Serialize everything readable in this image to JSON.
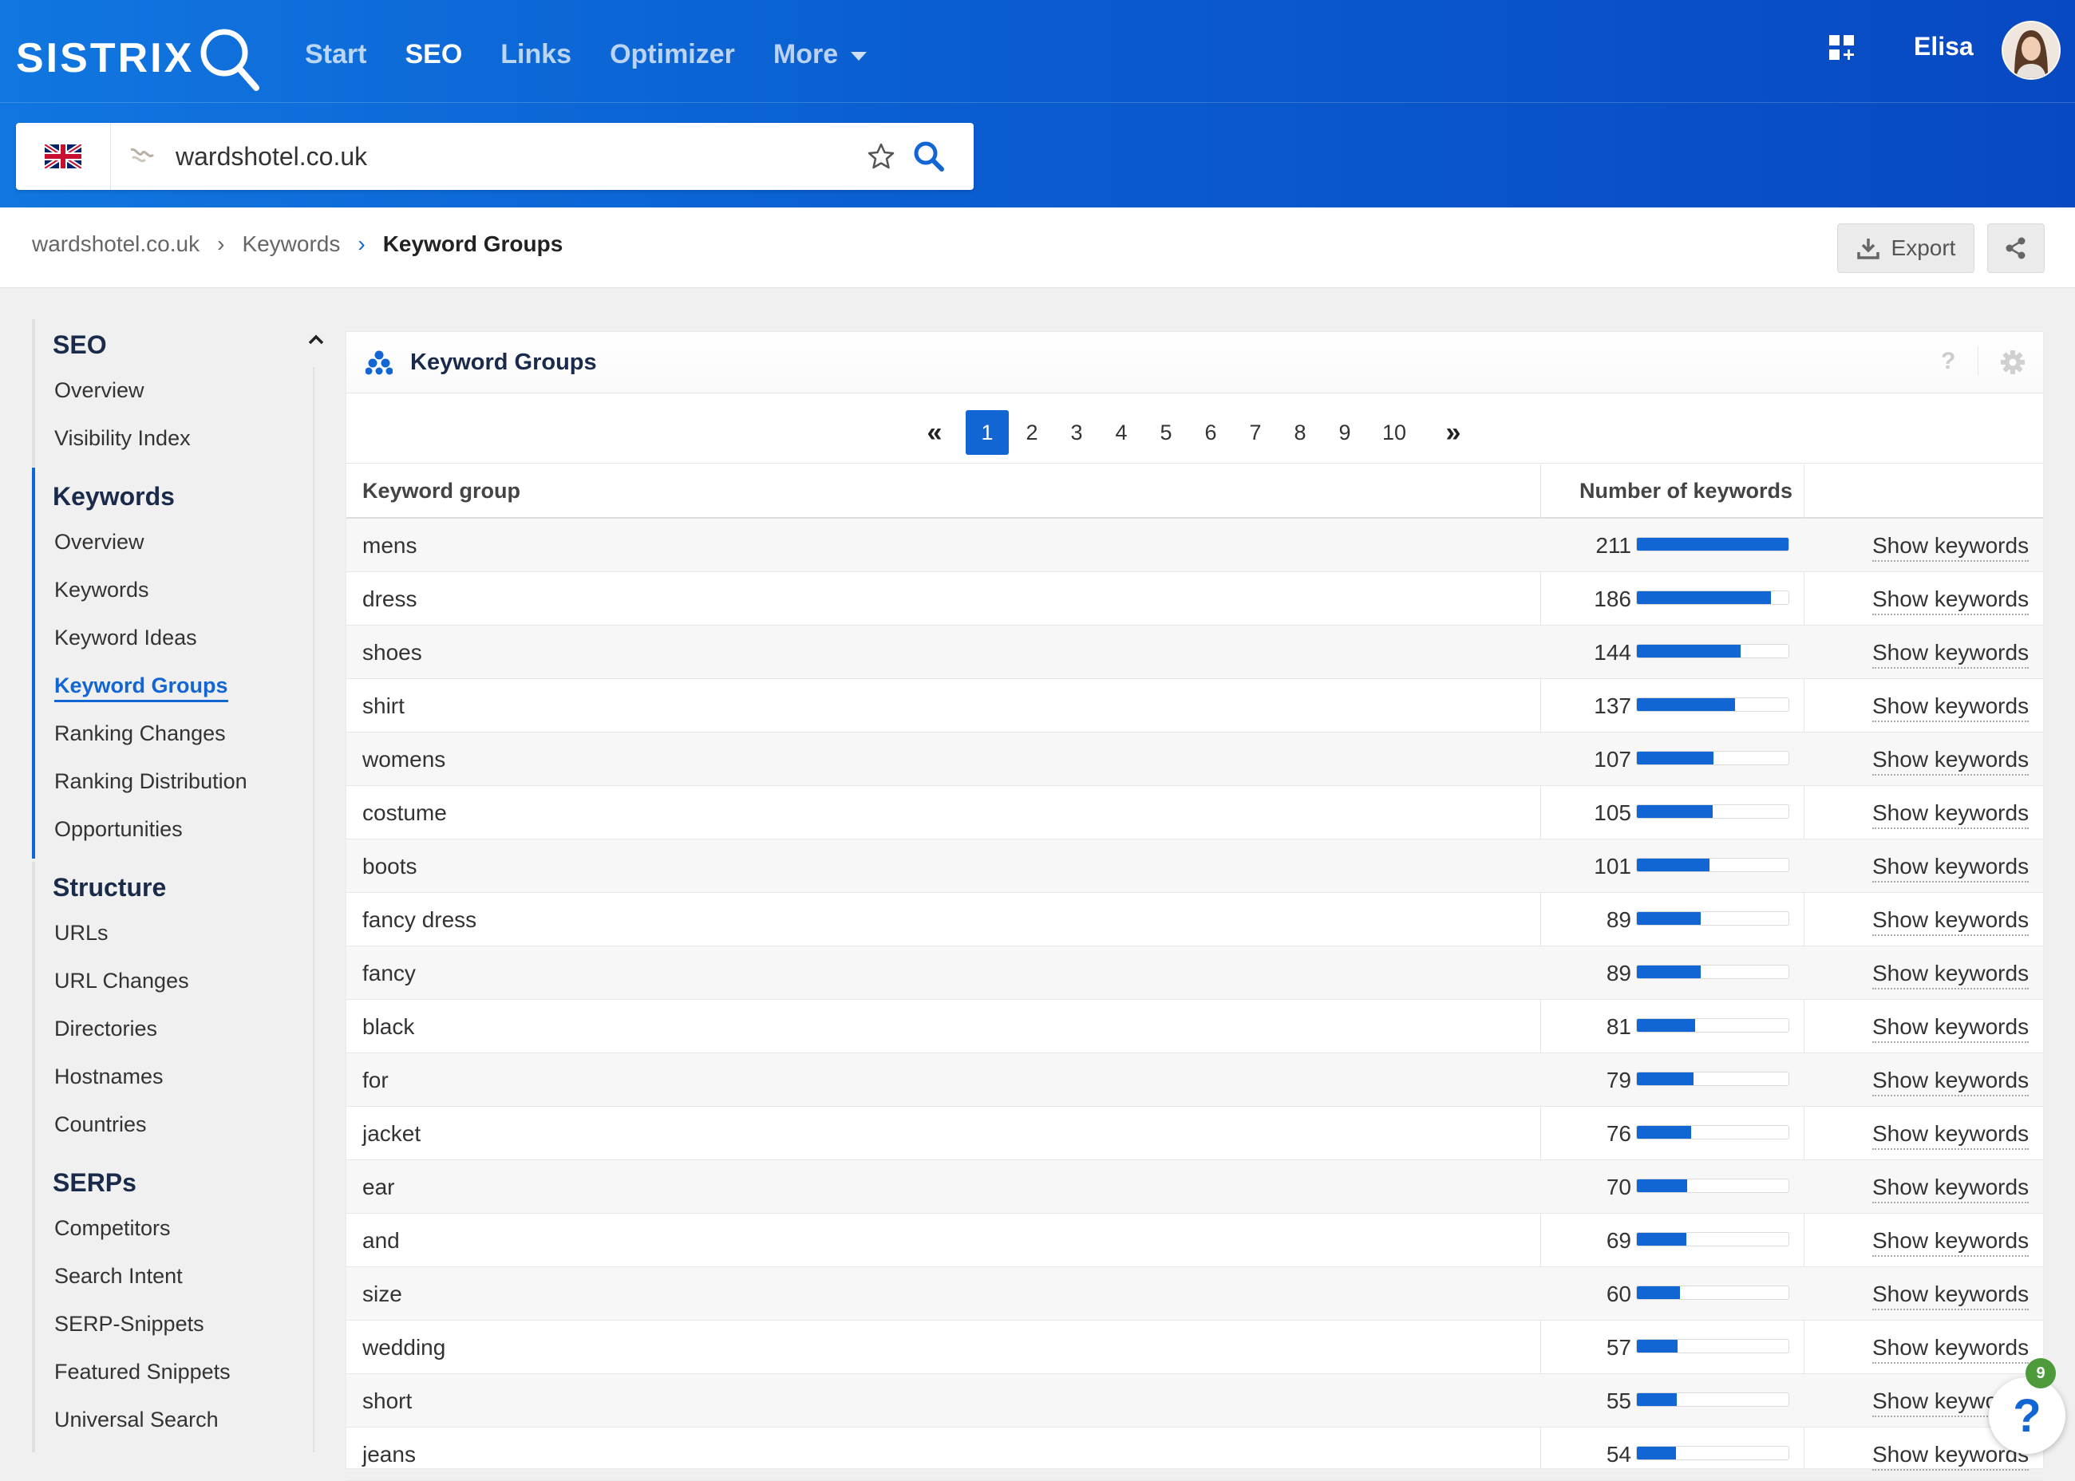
{
  "brand": {
    "name": "SISTRIX",
    "accent": "#1266d4"
  },
  "nav": {
    "items": [
      "Start",
      "SEO",
      "Links",
      "Optimizer",
      "More"
    ],
    "active": "SEO"
  },
  "user": {
    "name": "Elisa"
  },
  "search": {
    "value": "wardshotel.co.uk",
    "country_flag": "uk-flag-icon"
  },
  "breadcrumb": {
    "items": [
      "wardshotel.co.uk",
      "Keywords"
    ],
    "current": "Keyword Groups"
  },
  "toolbar": {
    "export_label": "Export"
  },
  "sidebar": {
    "seo": {
      "title": "SEO",
      "items": [
        "Overview",
        "Visibility Index"
      ]
    },
    "keywords": {
      "title": "Keywords",
      "items": [
        "Overview",
        "Keywords",
        "Keyword Ideas",
        "Keyword Groups",
        "Ranking Changes",
        "Ranking Distribution",
        "Opportunities"
      ],
      "active": "Keyword Groups"
    },
    "structure": {
      "title": "Structure",
      "items": [
        "URLs",
        "URL Changes",
        "Directories",
        "Hostnames",
        "Countries"
      ]
    },
    "serps": {
      "title": "SERPs",
      "items": [
        "Competitors",
        "Search Intent",
        "SERP-Snippets",
        "Featured Snippets",
        "Universal Search"
      ]
    }
  },
  "panel": {
    "title": "Keyword Groups",
    "help": "?",
    "pagination": {
      "first": "«",
      "last": "»",
      "pages": [
        "1",
        "2",
        "3",
        "4",
        "5",
        "6",
        "7",
        "8",
        "9",
        "10"
      ],
      "current": "1"
    },
    "columns": {
      "group": "Keyword group",
      "count": "Number of keywords"
    },
    "link_label": "Show keywords",
    "max_count": 211,
    "rows": [
      {
        "group": "mens",
        "count": 211
      },
      {
        "group": "dress",
        "count": 186
      },
      {
        "group": "shoes",
        "count": 144
      },
      {
        "group": "shirt",
        "count": 137
      },
      {
        "group": "womens",
        "count": 107
      },
      {
        "group": "costume",
        "count": 105
      },
      {
        "group": "boots",
        "count": 101
      },
      {
        "group": "fancy dress",
        "count": 89
      },
      {
        "group": "fancy",
        "count": 89
      },
      {
        "group": "black",
        "count": 81
      },
      {
        "group": "for",
        "count": 79
      },
      {
        "group": "jacket",
        "count": 76
      },
      {
        "group": "ear",
        "count": 70
      },
      {
        "group": "and",
        "count": 69
      },
      {
        "group": "size",
        "count": 60
      },
      {
        "group": "wedding",
        "count": 57
      },
      {
        "group": "short",
        "count": 55
      },
      {
        "group": "jeans",
        "count": 54
      }
    ]
  },
  "help_widget": {
    "label": "?",
    "badge": "9"
  }
}
